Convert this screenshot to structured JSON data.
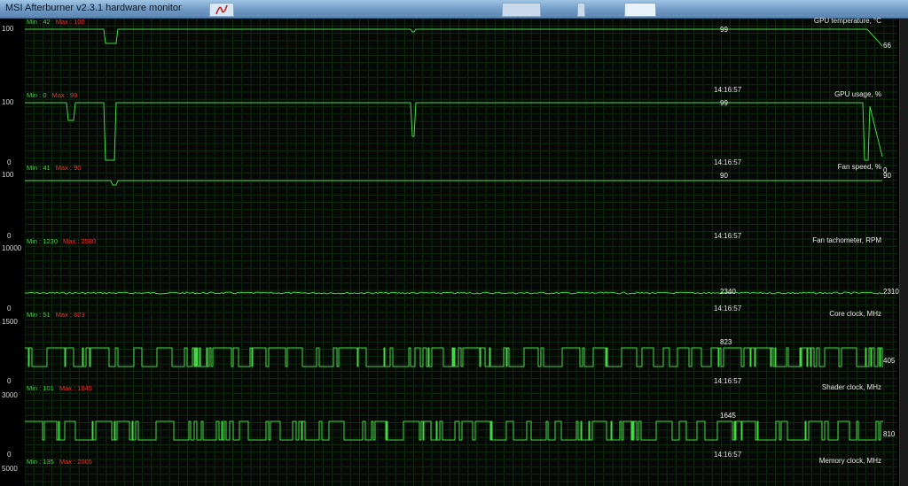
{
  "window": {
    "title": "MSI Afterburner v2.3.1 hardware monitor",
    "doc_icon": "pdf-document-icon"
  },
  "monitor": {
    "time": "14:16:57",
    "colors": {
      "line": "#45d845",
      "grid": "#0f2a0f",
      "min": "#38d838",
      "max": "#e83030",
      "text": "#e6e6e6"
    },
    "panels": [
      {
        "name": "GPU temperature, °C",
        "min_text": "Min : 42",
        "max_text": "Max : 100",
        "y_top": "100",
        "y_bottom": "",
        "marker_value": "99",
        "current": "66"
      },
      {
        "name": "GPU usage, %",
        "min_text": "Min : 0",
        "max_text": "Max : 99",
        "y_top": "100",
        "y_bottom": "0",
        "marker_value": "99",
        "current": "0"
      },
      {
        "name": "Fan speed, %",
        "min_text": "Min : 41",
        "max_text": "Max : 90",
        "y_top": "100",
        "y_bottom": "0",
        "marker_value": "90",
        "current": "90"
      },
      {
        "name": "Fan tachometer, RPM",
        "min_text": "Min : 1230",
        "max_text": "Max : 2580",
        "y_top": "10000",
        "y_bottom": "0",
        "marker_value": "2340",
        "current": "2310"
      },
      {
        "name": "Core clock, MHz",
        "min_text": "Min : 51",
        "max_text": "Max : 823",
        "y_top": "1500",
        "y_bottom": "0",
        "marker_value": "823",
        "current": "405"
      },
      {
        "name": "Shader clock, MHz",
        "min_text": "Min : 101",
        "max_text": "Max : 1645",
        "y_top": "3000",
        "y_bottom": "0",
        "marker_value": "1645",
        "current": "810"
      },
      {
        "name": "Memory clock, MHz",
        "min_text": "Min : 135",
        "max_text": "Max : 2005",
        "y_top": "5000",
        "y_bottom": "",
        "marker_value": "",
        "current": ""
      }
    ]
  }
}
